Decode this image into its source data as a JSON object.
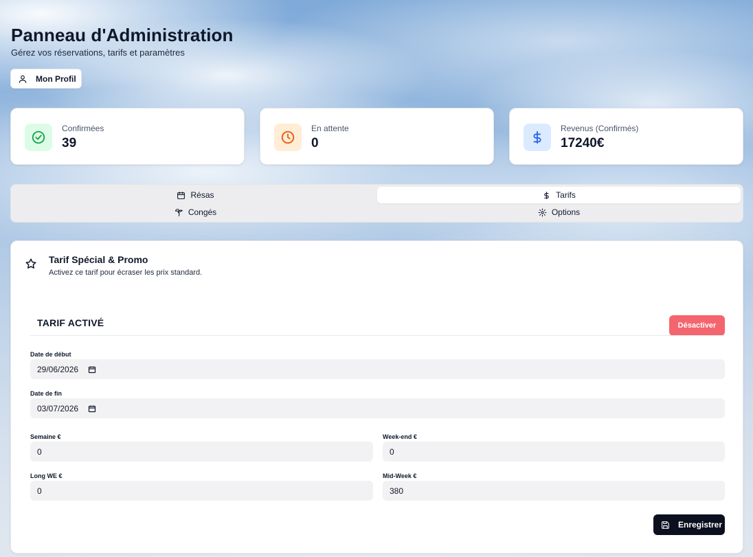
{
  "header": {
    "title": "Panneau d'Administration",
    "subtitle": "Gérez vos réservations, tarifs et paramètres",
    "profile_button": "Mon Profil",
    "profile_icon": "user-icon"
  },
  "stats": [
    {
      "label": "Confirmées",
      "value": "39",
      "icon": "check-circle-icon",
      "color": "#16a34a",
      "bg": "#dcfce7"
    },
    {
      "label": "En attente",
      "value": "0",
      "icon": "clock-icon",
      "color": "#ea580c",
      "bg": "#ffedd5"
    },
    {
      "label": "Revenus (Confirmés)",
      "value": "17240€",
      "icon": "dollar-icon",
      "color": "#2563eb",
      "bg": "#dbeafe"
    }
  ],
  "tabs": [
    {
      "label": "Résas",
      "icon": "calendar-icon",
      "active": false
    },
    {
      "label": "Tarifs",
      "icon": "dollar-icon",
      "active": true
    },
    {
      "label": "Congés",
      "icon": "palm-tree-icon",
      "active": false
    },
    {
      "label": "Options",
      "icon": "gear-icon",
      "active": false
    }
  ],
  "promo": {
    "title": "Tarif Spécial & Promo",
    "description": "Activez ce tarif pour écraser les prix standard.",
    "status_title": "TARIF ACTIVÉ",
    "deactivate_button": "Désactiver",
    "start_date_label": "Date de début",
    "start_date_value": "29/06/2026",
    "end_date_label": "Date de fin",
    "end_date_value": "03/07/2026",
    "week_label": "Semaine €",
    "week_value": "0",
    "weekend_label": "Week-end €",
    "weekend_value": "0",
    "long_we_label": "Long WE €",
    "long_we_value": "0",
    "midweek_label": "Mid-Week €",
    "midweek_value": "380",
    "save_button": "Enregistrer"
  },
  "colors": {
    "danger": "#f4656e",
    "primary_dark": "#0b0f1e"
  }
}
